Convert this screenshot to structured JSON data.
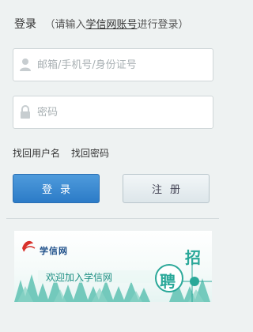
{
  "header": {
    "title": "登录",
    "hint_open": "（请输入",
    "hint_account": "学信网账号",
    "hint_close": "进行登录）"
  },
  "form": {
    "username_placeholder": "邮箱/手机号/身份证号",
    "password_placeholder": "密码"
  },
  "links": {
    "find_username": "找回用户名",
    "find_password": "找回密码"
  },
  "buttons": {
    "login": "登录",
    "register": "注册"
  },
  "banner": {
    "logo_text": "学信网",
    "slogan": "欢迎加入学信网",
    "char_top": "招",
    "char_circle": "聘"
  },
  "colors": {
    "login_button": "#2c7bc7",
    "banner_teal": "#2aa899",
    "background": "#eef2f2"
  }
}
